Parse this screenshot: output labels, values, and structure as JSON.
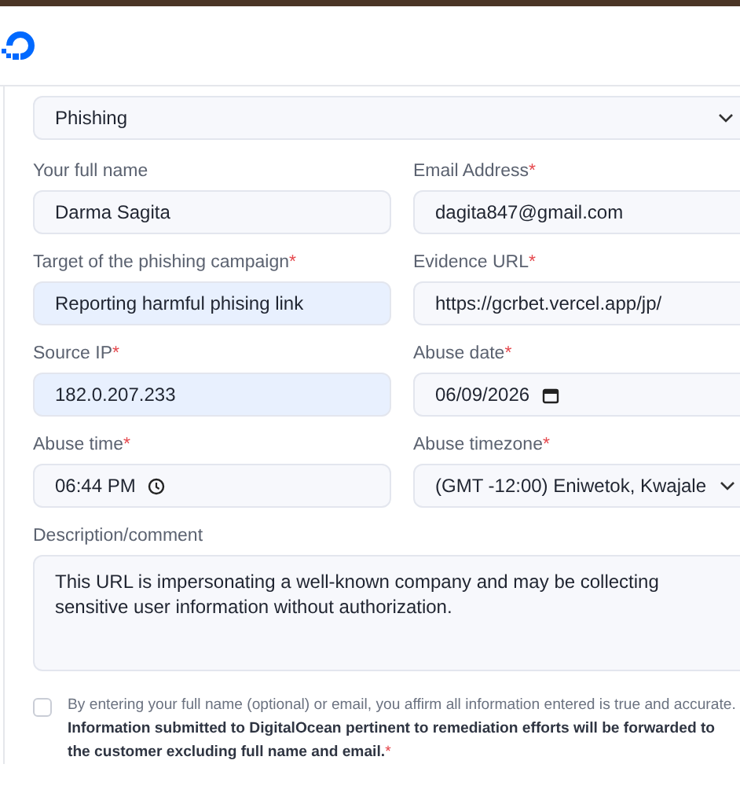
{
  "category_select": {
    "value": "Phishing"
  },
  "fields": [
    {
      "kind": "text",
      "label": "Your full name",
      "value": "Darma Sagita",
      "autofilled": false
    },
    {
      "kind": "text",
      "label": "Email Address",
      "required_mark": "*",
      "value": "dagita847@gmail.com",
      "autofilled": false
    },
    {
      "kind": "text",
      "label": "Target of the phishing campaign",
      "required_mark": "*",
      "value": "Reporting harmful phising link",
      "autofilled": true
    },
    {
      "kind": "text",
      "label": "Evidence URL",
      "required_mark": "*",
      "value": "https://gcrbet.vercel.app/jp/",
      "autofilled": false
    },
    {
      "kind": "text",
      "label": "Source IP",
      "required_mark": "*",
      "value": "182.0.207.233",
      "autofilled": true
    },
    {
      "kind": "date",
      "label": "Abuse date",
      "required_mark": "*",
      "value": "06/09/2026",
      "autofilled": false
    },
    {
      "kind": "time",
      "label": "Abuse time",
      "required_mark": "*",
      "value": "06:44 PM",
      "autofilled": false
    },
    {
      "kind": "select",
      "label": "Abuse timezone",
      "required_mark": "*",
      "value": "(GMT -12:00) Eniwetok, Kwajale",
      "autofilled": false
    }
  ],
  "description": {
    "label": "Description/comment",
    "value": "This URL is impersonating a well-known company and may be collecting sensitive user information without authorization."
  },
  "consent": {
    "checked": false,
    "text": "By entering your full name (optional) or email, you affirm all information entered is true and accurate. **Information submitted to DigitalOcean pertinent to remediation efforts will be forwarded to the customer excluding full name and email.**",
    "required_mark": "*"
  }
}
